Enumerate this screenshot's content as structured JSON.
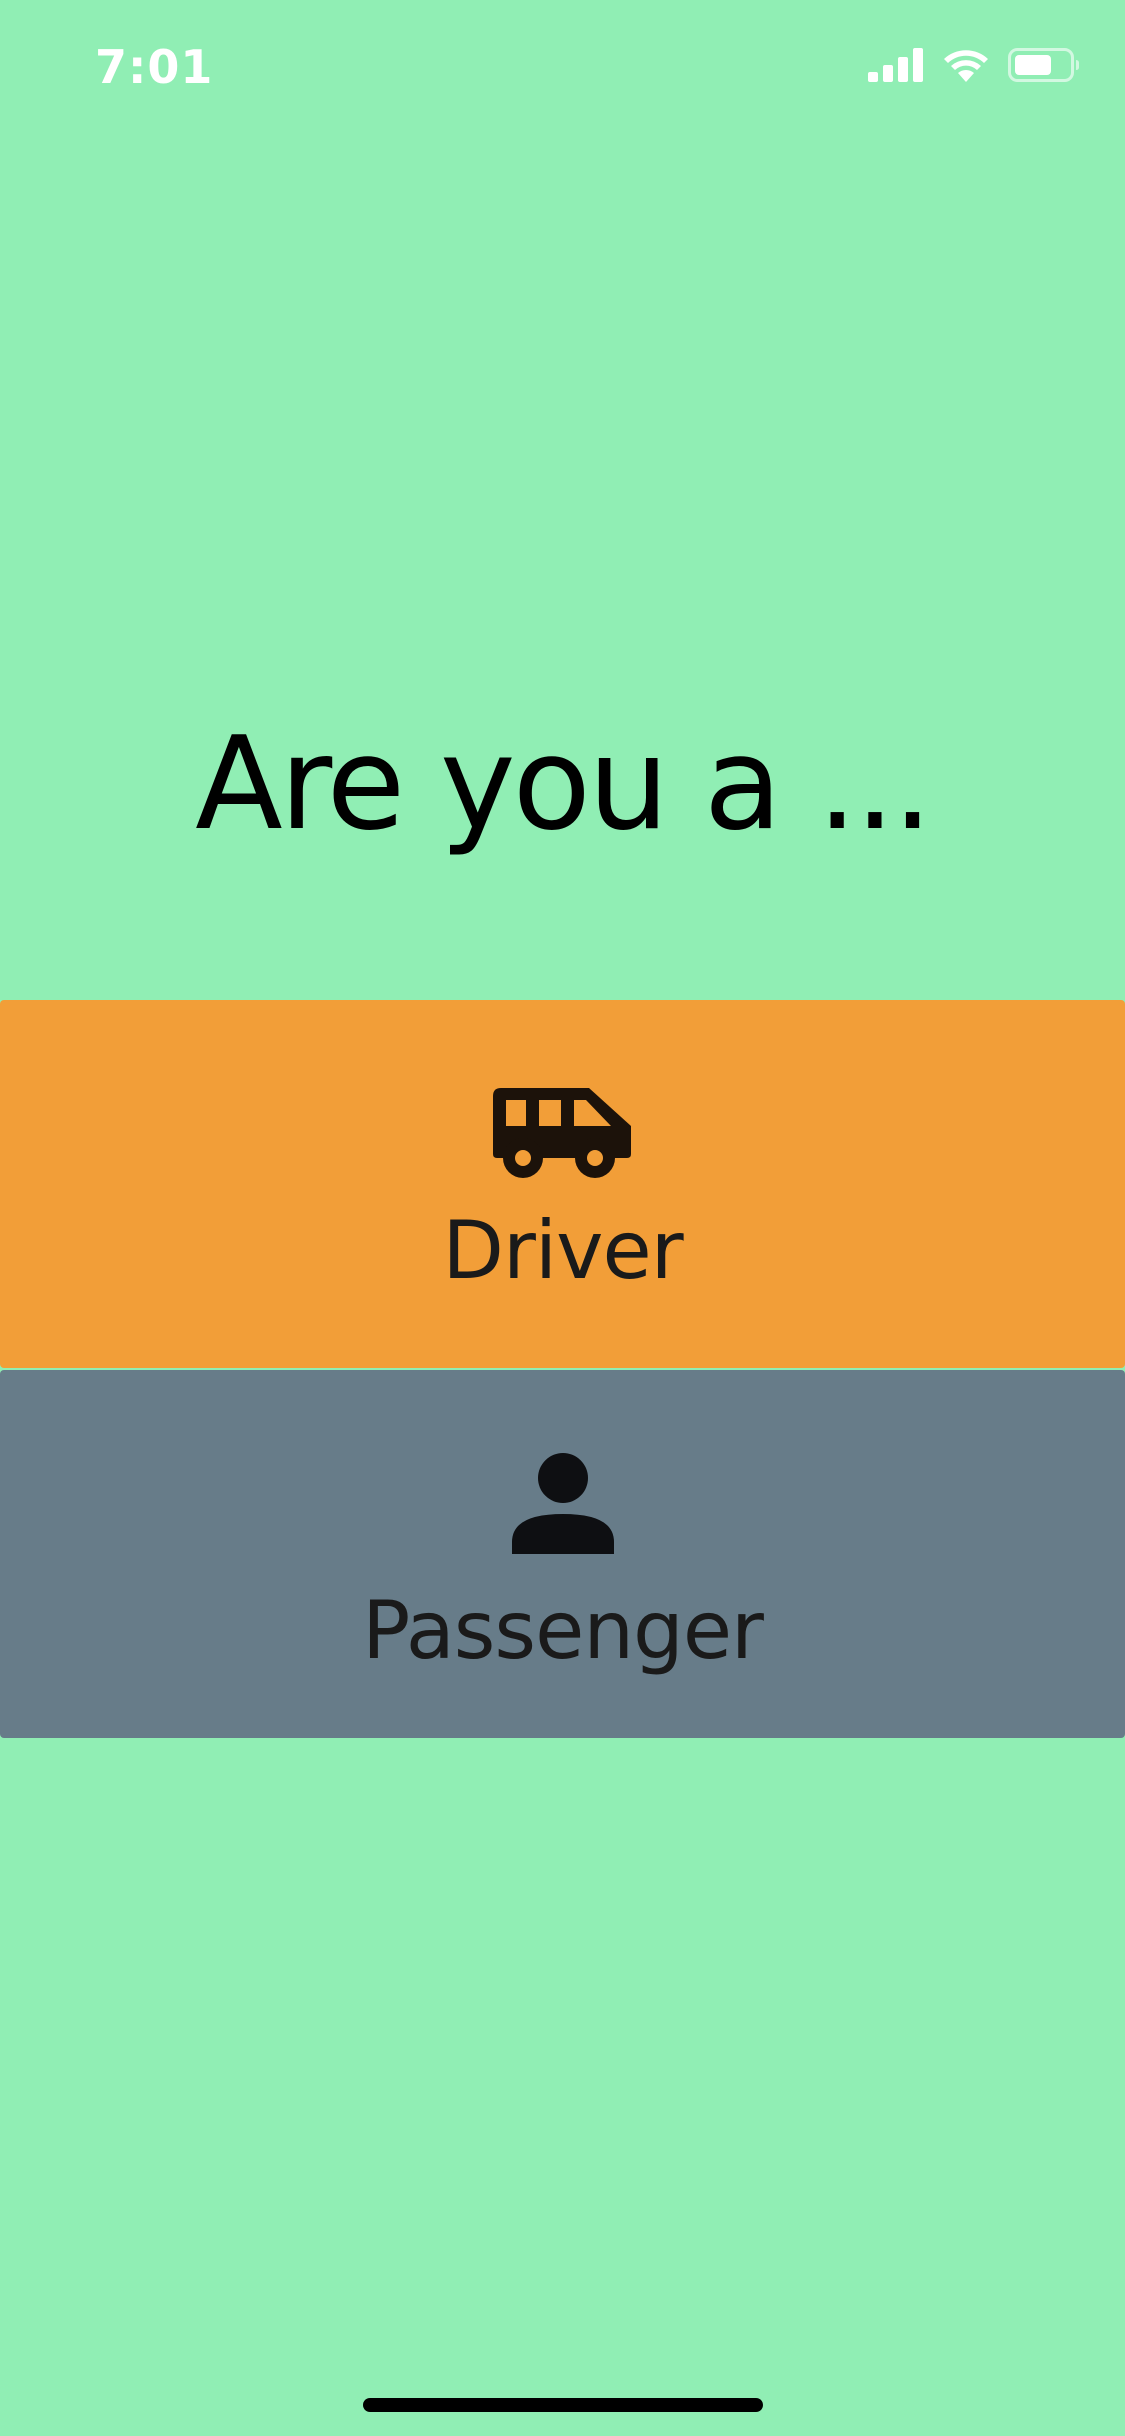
{
  "status_bar": {
    "time": "7:01",
    "icons": [
      "cellular-signal-icon",
      "wifi-icon",
      "battery-icon"
    ]
  },
  "title": "Are you a ...",
  "options": {
    "driver": {
      "label": "Driver",
      "icon": "van-icon",
      "color": "#F29E38"
    },
    "passenger": {
      "label": "Passenger",
      "icon": "person-icon",
      "color": "#677C89"
    }
  },
  "colors": {
    "background": "#90EEB4",
    "text": "#1a1a1a"
  }
}
